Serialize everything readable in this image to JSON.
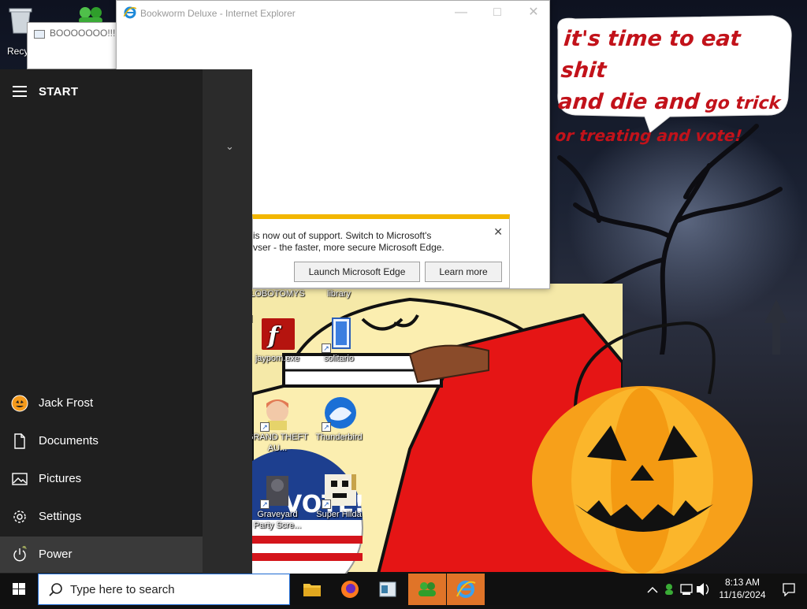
{
  "desktop": {
    "recycle_label": "Recy",
    "speech_line1": "it's time to eat shit",
    "speech_line2a": "and die and",
    "speech_line2b": " go trick",
    "speech_line3": "or treating and vote!",
    "icons": [
      {
        "label": "LOBOTOMYS"
      },
      {
        "label": "library"
      },
      {
        "label": "jaypom.exe"
      },
      {
        "label": "solitario"
      },
      {
        "label": "GRAND THEFT AU..."
      },
      {
        "label": "Thunderbird"
      },
      {
        "label": "Graveyard Party Scre..."
      },
      {
        "label": "Super Hilda"
      }
    ],
    "vote_text": "VOTE!"
  },
  "boo_window": {
    "title": "BOOOOOOO!!!!"
  },
  "ie_window": {
    "title": "Bookworm Deluxe - Internet Explorer",
    "banner": {
      "line1": "is now out of support. Switch to Microsoft's",
      "line2": "vser - the faster, more secure Microsoft Edge.",
      "launch_edge": "Launch Microsoft Edge",
      "learn_more": "Learn more"
    }
  },
  "start_menu": {
    "title": "START",
    "items": [
      {
        "label": "Jack Frost",
        "icon": "user-avatar-icon"
      },
      {
        "label": "Documents",
        "icon": "document-icon"
      },
      {
        "label": "Pictures",
        "icon": "pictures-icon"
      },
      {
        "label": "Settings",
        "icon": "gear-icon"
      },
      {
        "label": "Power",
        "icon": "power-icon"
      }
    ]
  },
  "taskbar": {
    "search_placeholder": "Type here to search",
    "apps": [
      "file-explorer",
      "firefox",
      "notepad-app",
      "users-app",
      "internet-explorer"
    ],
    "time": "8:13 AM",
    "date": "11/16/2024"
  },
  "colors": {
    "accent_orange": "#e07428",
    "warning_yellow": "#f2b600",
    "speech_red": "#c2121a"
  }
}
